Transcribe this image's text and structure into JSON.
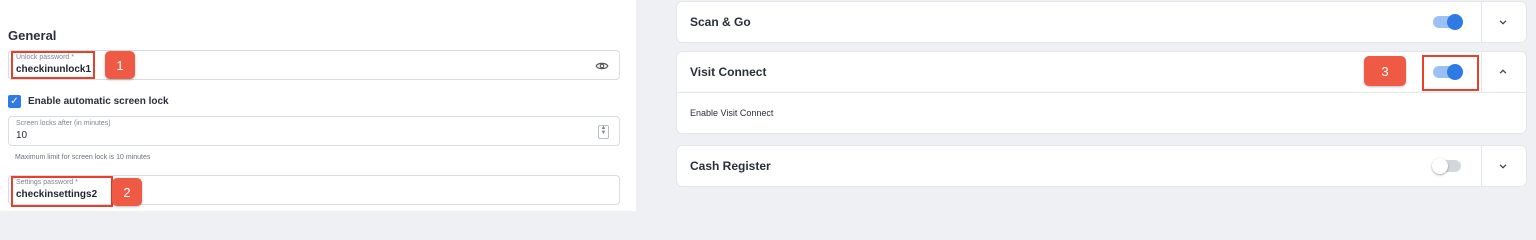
{
  "general": {
    "title": "General",
    "unlock_password": {
      "label": "Unlock password *",
      "value": "checkinunlock1"
    },
    "auto_lock": {
      "label": "Enable automatic screen lock",
      "checked": true
    },
    "screen_lock": {
      "label": "Screen locks after (in minutes)",
      "value": "10"
    },
    "hint": "Maximum limit for screen lock is 10 minutes",
    "settings_password": {
      "label": "Settings password *",
      "value": "checkinsettings2"
    }
  },
  "callouts": [
    "1",
    "2",
    "3"
  ],
  "modules": [
    {
      "title": "Scan & Go",
      "enabled": true,
      "expanded": false
    },
    {
      "title": "Visit Connect",
      "enabled": true,
      "expanded": true,
      "body": "Enable Visit Connect"
    },
    {
      "title": "Cash Register",
      "enabled": false,
      "expanded": false
    }
  ],
  "colors": {
    "accent": "#2f7be6",
    "callout": "#ef5a45"
  }
}
